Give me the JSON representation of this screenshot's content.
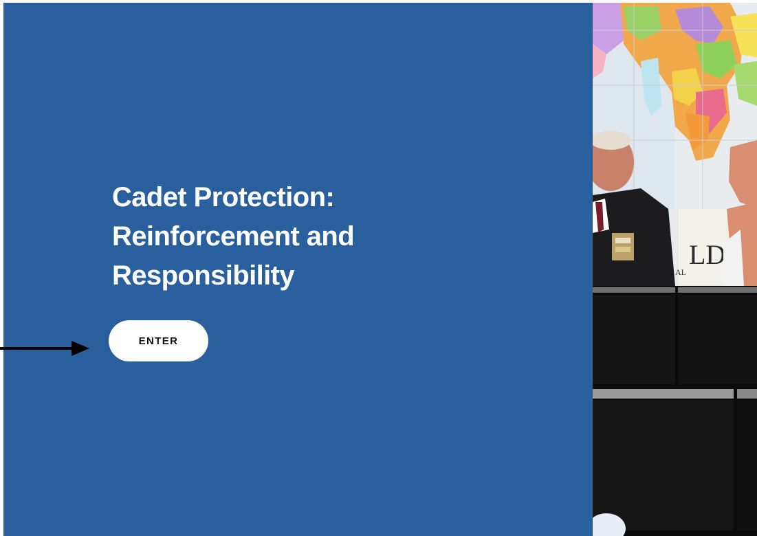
{
  "hero": {
    "title_lines": [
      "Cadet Protection:",
      "Reinforcement and",
      "Responsibility"
    ],
    "enter_label": "ENTER"
  },
  "photo": {
    "map_sign_text": "LD",
    "map_sign_subtext": "AL"
  },
  "colors": {
    "panel_blue": "#2a5f9e",
    "button_bg": "#ffffff",
    "title_text": "#ffffff",
    "button_text": "#111111",
    "arrow": "#000000"
  },
  "icons": {
    "pointer": "arrow-right-icon"
  }
}
